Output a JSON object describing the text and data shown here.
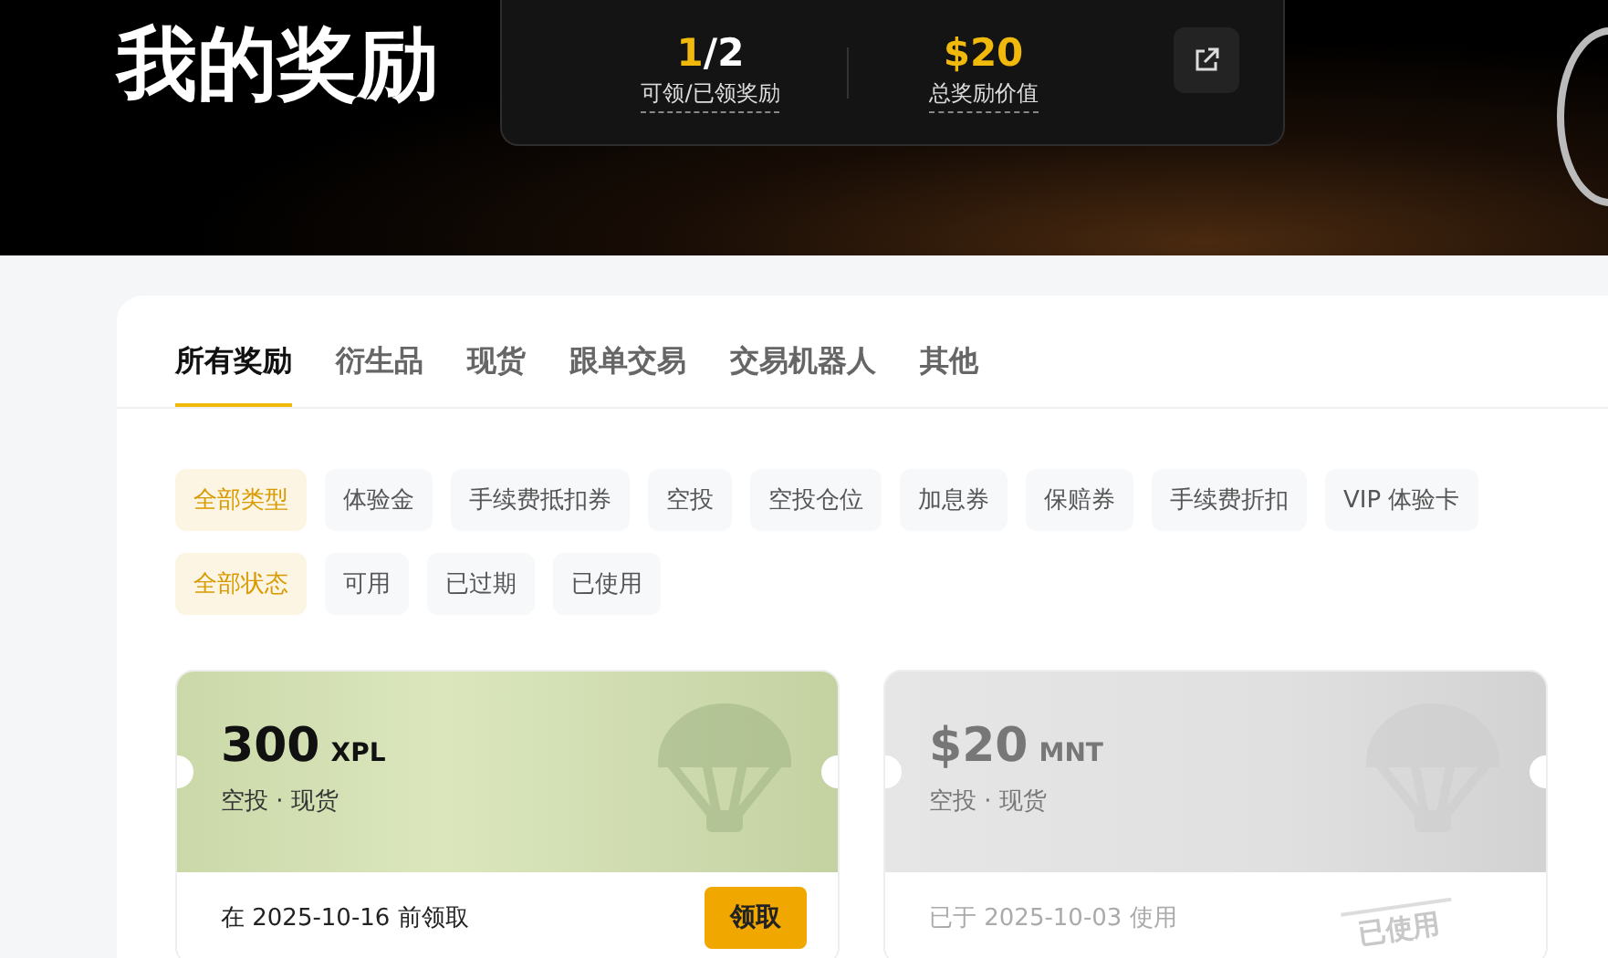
{
  "header": {
    "title": "我的奖励",
    "stats": [
      {
        "value_highlight": "1",
        "value_rest": "/2",
        "label": "可领/已领奖励"
      },
      {
        "value_highlight": "$20",
        "label": "总奖励价值"
      }
    ]
  },
  "tabs": [
    {
      "label": "所有奖励",
      "selected": true
    },
    {
      "label": "衍生品",
      "selected": false
    },
    {
      "label": "现货",
      "selected": false
    },
    {
      "label": "跟单交易",
      "selected": false
    },
    {
      "label": "交易机器人",
      "selected": false
    },
    {
      "label": "其他",
      "selected": false
    }
  ],
  "type_filters": [
    {
      "label": "全部类型",
      "selected": true
    },
    {
      "label": "体验金",
      "selected": false
    },
    {
      "label": "手续费抵扣券",
      "selected": false
    },
    {
      "label": "空投",
      "selected": false
    },
    {
      "label": "空投仓位",
      "selected": false
    },
    {
      "label": "加息券",
      "selected": false
    },
    {
      "label": "保赔券",
      "selected": false
    },
    {
      "label": "手续费折扣",
      "selected": false
    },
    {
      "label": "VIP 体验卡",
      "selected": false
    }
  ],
  "status_filters": [
    {
      "label": "全部状态",
      "selected": true
    },
    {
      "label": "可用",
      "selected": false
    },
    {
      "label": "已过期",
      "selected": false
    },
    {
      "label": "已使用",
      "selected": false
    }
  ],
  "rewards": [
    {
      "amount": "300",
      "unit": "XPL",
      "category": "空投 · 现货",
      "note": "在 2025-10-16 前领取",
      "used": false,
      "button": "领取"
    },
    {
      "amount": "$20",
      "unit": "MNT",
      "category": "空投 · 现货",
      "note": "已于 2025-10-03 使用",
      "used": true,
      "stamp": "已使用"
    }
  ]
}
